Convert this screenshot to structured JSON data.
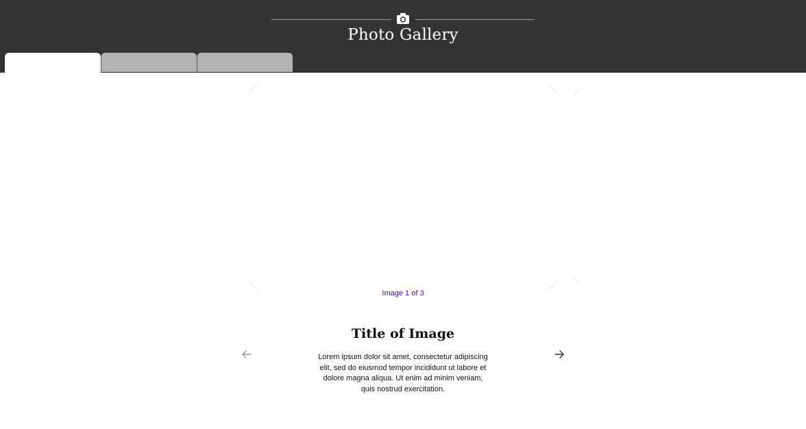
{
  "header": {
    "title": "Photo Gallery",
    "icon": "camera-icon"
  },
  "tabs": [
    {
      "label": "",
      "active": true
    },
    {
      "label": "",
      "active": false
    },
    {
      "label": "",
      "active": false
    }
  ],
  "gallery": {
    "counter": "Image 1 of 3",
    "image_title": "Title of Image",
    "description": "Lorem ipsum dolor sit amet, consectetur adipiscing elit, sed do eiusmod tempor incididunt ut labore et dolore magna aliqua. Ut enim ad minim veniam, quis nostrud exercitation.",
    "prev_icon": "arrow-left-icon",
    "next_icon": "arrow-right-icon"
  },
  "colors": {
    "header_bg": "#333333",
    "counter_link": "#3a0ad6",
    "tab_inactive": "#b3b3b3"
  }
}
